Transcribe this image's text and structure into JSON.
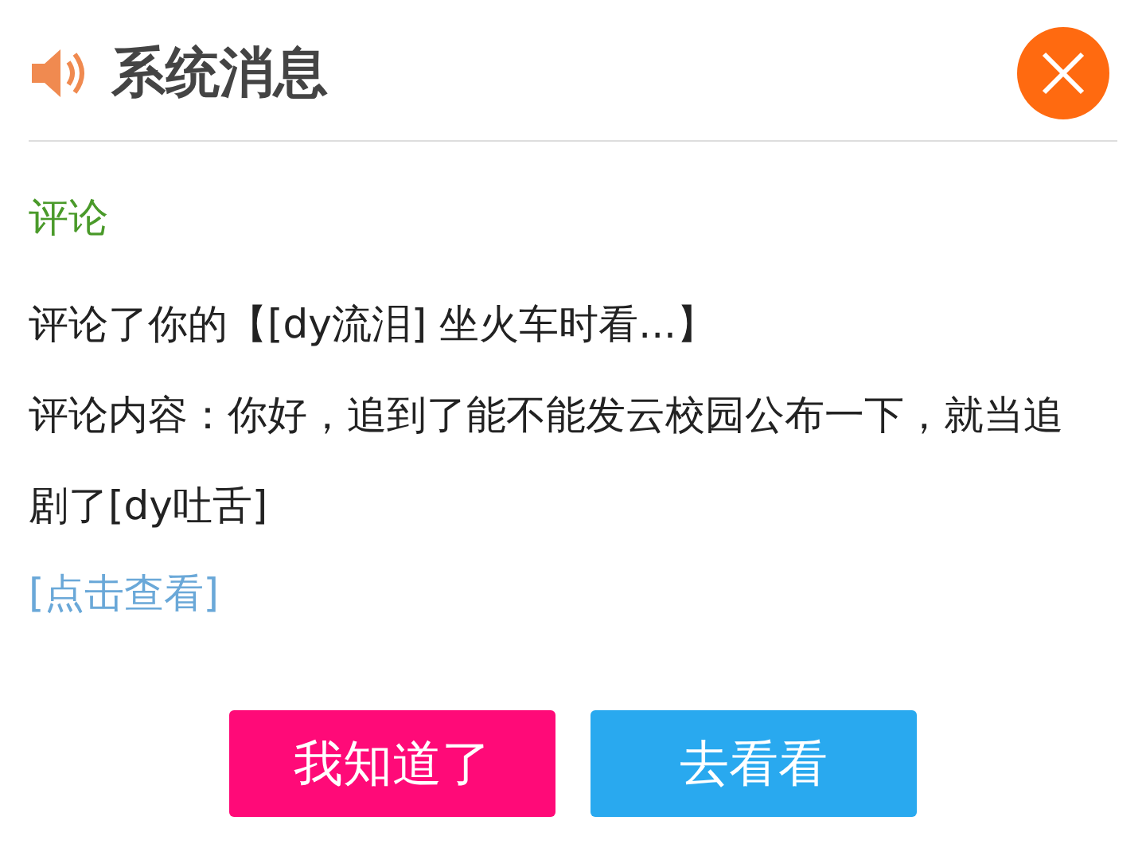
{
  "header": {
    "title": "系统消息"
  },
  "message": {
    "category": "评论",
    "lines": [
      "评论了你的【[dy流泪] 坐火车时看...】",
      "评论内容：你好，追到了能不能发云校园公布一下，就当追剧了[dy吐舌]"
    ],
    "link": "[点击查看]"
  },
  "buttons": [
    {
      "label": "我知道了",
      "kind": "dismiss"
    },
    {
      "label": "去看看",
      "kind": "go"
    }
  ]
}
